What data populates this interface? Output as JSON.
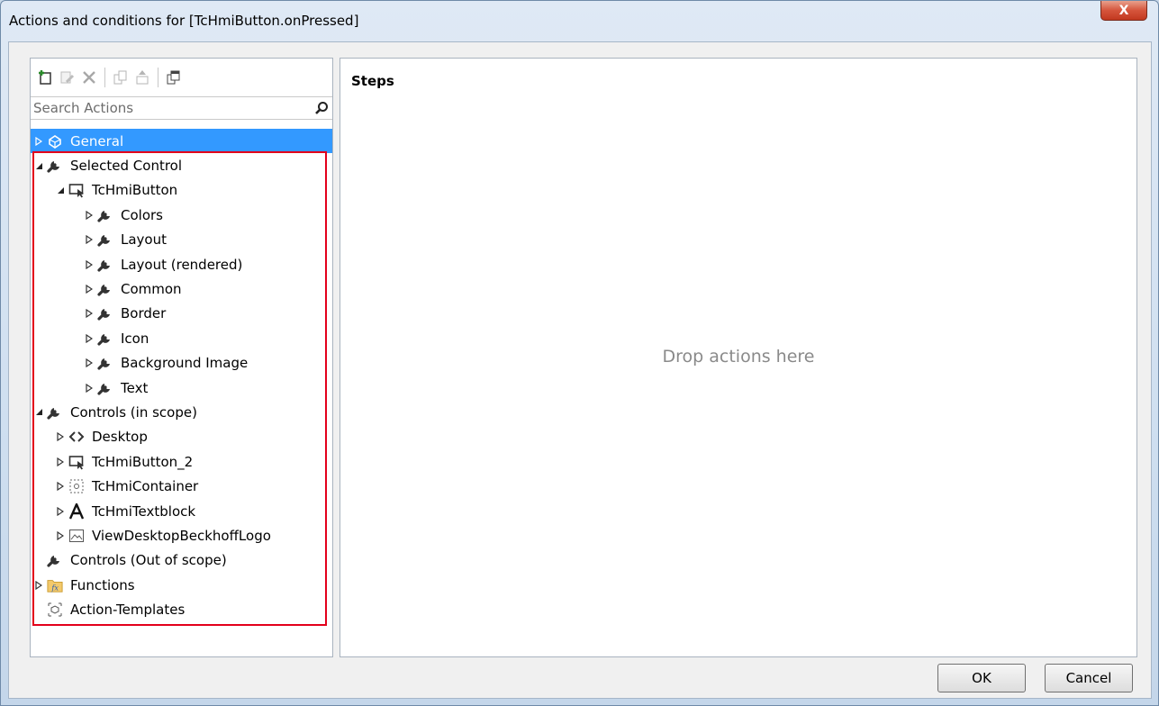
{
  "window": {
    "title": "Actions and conditions for [TcHmiButton.onPressed]",
    "close_label": "X"
  },
  "left_panel": {
    "toolbar_icons": [
      "add-icon",
      "edit-icon",
      "delete-icon",
      "copy-icon",
      "move-icon",
      "duplicate-icon"
    ],
    "search_placeholder": "Search Actions"
  },
  "tree": [
    {
      "label": "General",
      "level": 0,
      "expander": "collapsed",
      "icon": "general-icon",
      "selected": true
    },
    {
      "label": "Selected Control",
      "level": 0,
      "expander": "expanded",
      "icon": "wrench-icon"
    },
    {
      "label": "TcHmiButton",
      "level": 1,
      "expander": "expanded",
      "icon": "button-control-icon"
    },
    {
      "label": "Colors",
      "level": 2,
      "expander": "collapsed",
      "icon": "wrench-icon"
    },
    {
      "label": "Layout",
      "level": 2,
      "expander": "collapsed",
      "icon": "wrench-icon"
    },
    {
      "label": "Layout (rendered)",
      "level": 2,
      "expander": "collapsed",
      "icon": "wrench-icon"
    },
    {
      "label": "Common",
      "level": 2,
      "expander": "collapsed",
      "icon": "wrench-icon"
    },
    {
      "label": "Border",
      "level": 2,
      "expander": "collapsed",
      "icon": "wrench-icon"
    },
    {
      "label": "Icon",
      "level": 2,
      "expander": "collapsed",
      "icon": "wrench-icon"
    },
    {
      "label": "Background Image",
      "level": 2,
      "expander": "collapsed",
      "icon": "wrench-icon"
    },
    {
      "label": "Text",
      "level": 2,
      "expander": "collapsed",
      "icon": "wrench-icon"
    },
    {
      "label": "Controls (in scope)",
      "level": 0,
      "expander": "expanded",
      "icon": "wrench-icon"
    },
    {
      "label": "Desktop",
      "level": 1,
      "expander": "collapsed",
      "icon": "code-icon"
    },
    {
      "label": "TcHmiButton_2",
      "level": 1,
      "expander": "collapsed",
      "icon": "button-control-icon"
    },
    {
      "label": "TcHmiContainer",
      "level": 1,
      "expander": "collapsed",
      "icon": "container-icon"
    },
    {
      "label": "TcHmiTextblock",
      "level": 1,
      "expander": "collapsed",
      "icon": "textblock-icon"
    },
    {
      "label": "ViewDesktopBeckhoffLogo",
      "level": 1,
      "expander": "collapsed",
      "icon": "image-icon"
    },
    {
      "label": "Controls (Out of scope)",
      "level": 0,
      "expander": "none",
      "icon": "wrench-icon"
    },
    {
      "label": "Functions",
      "level": 0,
      "expander": "collapsed",
      "icon": "functions-icon"
    },
    {
      "label": "Action-Templates",
      "level": 0,
      "expander": "none",
      "icon": "templates-icon"
    }
  ],
  "right_panel": {
    "title": "Steps",
    "drop_hint": "Drop actions here"
  },
  "buttons": {
    "ok": "OK",
    "cancel": "Cancel"
  },
  "colors": {
    "selection": "#3399ff",
    "highlight_box": "#e3001b"
  }
}
